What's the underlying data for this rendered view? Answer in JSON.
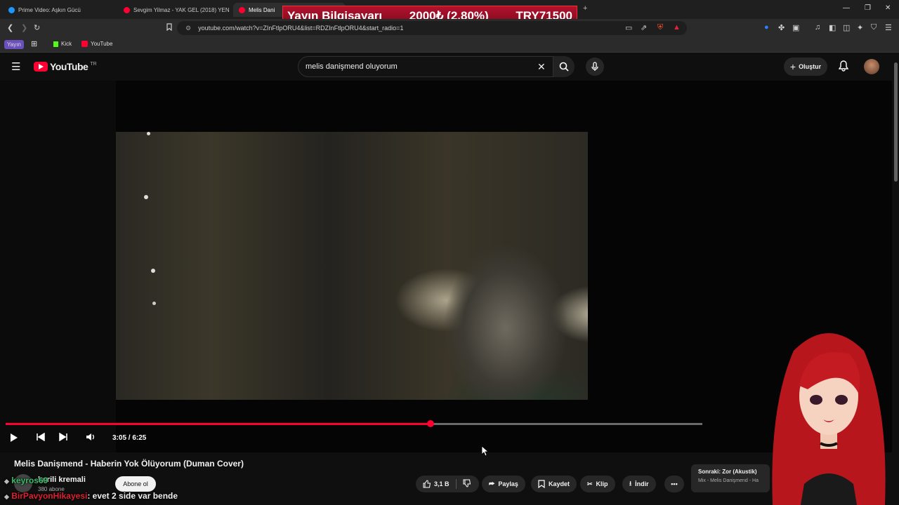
{
  "browser": {
    "tabs": [
      {
        "title": "Prime Video: Aşkın Gücü",
        "color": "#1a98ff"
      },
      {
        "title": "Sevgim Yilmaz - YAK GEL (2018) YEN",
        "color": "#ff0033"
      },
      {
        "title": "Melis Dani",
        "color": "#ff0033"
      }
    ],
    "new_tab": "+",
    "url": "youtube.com/watch?v=ZInFtlpORU4&list=RDZInFtlpORU4&start_radio=1",
    "bookmarks": [
      {
        "label": "Yayın"
      },
      {
        "label": "Kick",
        "color": "#53fc18"
      },
      {
        "label": "YouTube",
        "color": "#ff0033"
      }
    ],
    "window_controls": [
      "—",
      "❐",
      "✕"
    ]
  },
  "overlay_banner": {
    "product": "Yayın Bilgisayarı",
    "progress": "2000₺ (2.80%)",
    "goal": "TRY71500",
    "progress_fraction": 0.028
  },
  "youtube": {
    "logo": "YouTube",
    "region": "TR",
    "search_query": "melis danişmend oluyorum",
    "create_label": "Oluştur",
    "video": {
      "current_time": "3:05",
      "duration": "6:25",
      "time_display": "3:05 / 6:25",
      "progress_fraction": 0.61,
      "title": "Melis Danişmend - Haberin Yok Ölüyorum (Duman Cover)"
    },
    "channel": {
      "name": "korili kremali",
      "subscribers": "380 abone",
      "subscribe_label": "Abone ol"
    },
    "actions": {
      "likes": "3,1 B",
      "share": "Paylaş",
      "save": "Kaydet",
      "clip": "Klip",
      "download": "İndir"
    },
    "next": {
      "label": "Sonraki: Zor (Akustik)",
      "subtitle": "Mix - Melis Danişmend - Ha"
    }
  },
  "chat": [
    {
      "user": "keyros69",
      "message": "",
      "color": "#3dbb6b"
    },
    {
      "user": "BirPavyonHikayesi",
      "message": ": evet 2 side var bende",
      "color": "#e0202f"
    }
  ],
  "colors": {
    "accent": "#ff0033",
    "background": "#0f0f0f",
    "banner": "#b3122e"
  }
}
